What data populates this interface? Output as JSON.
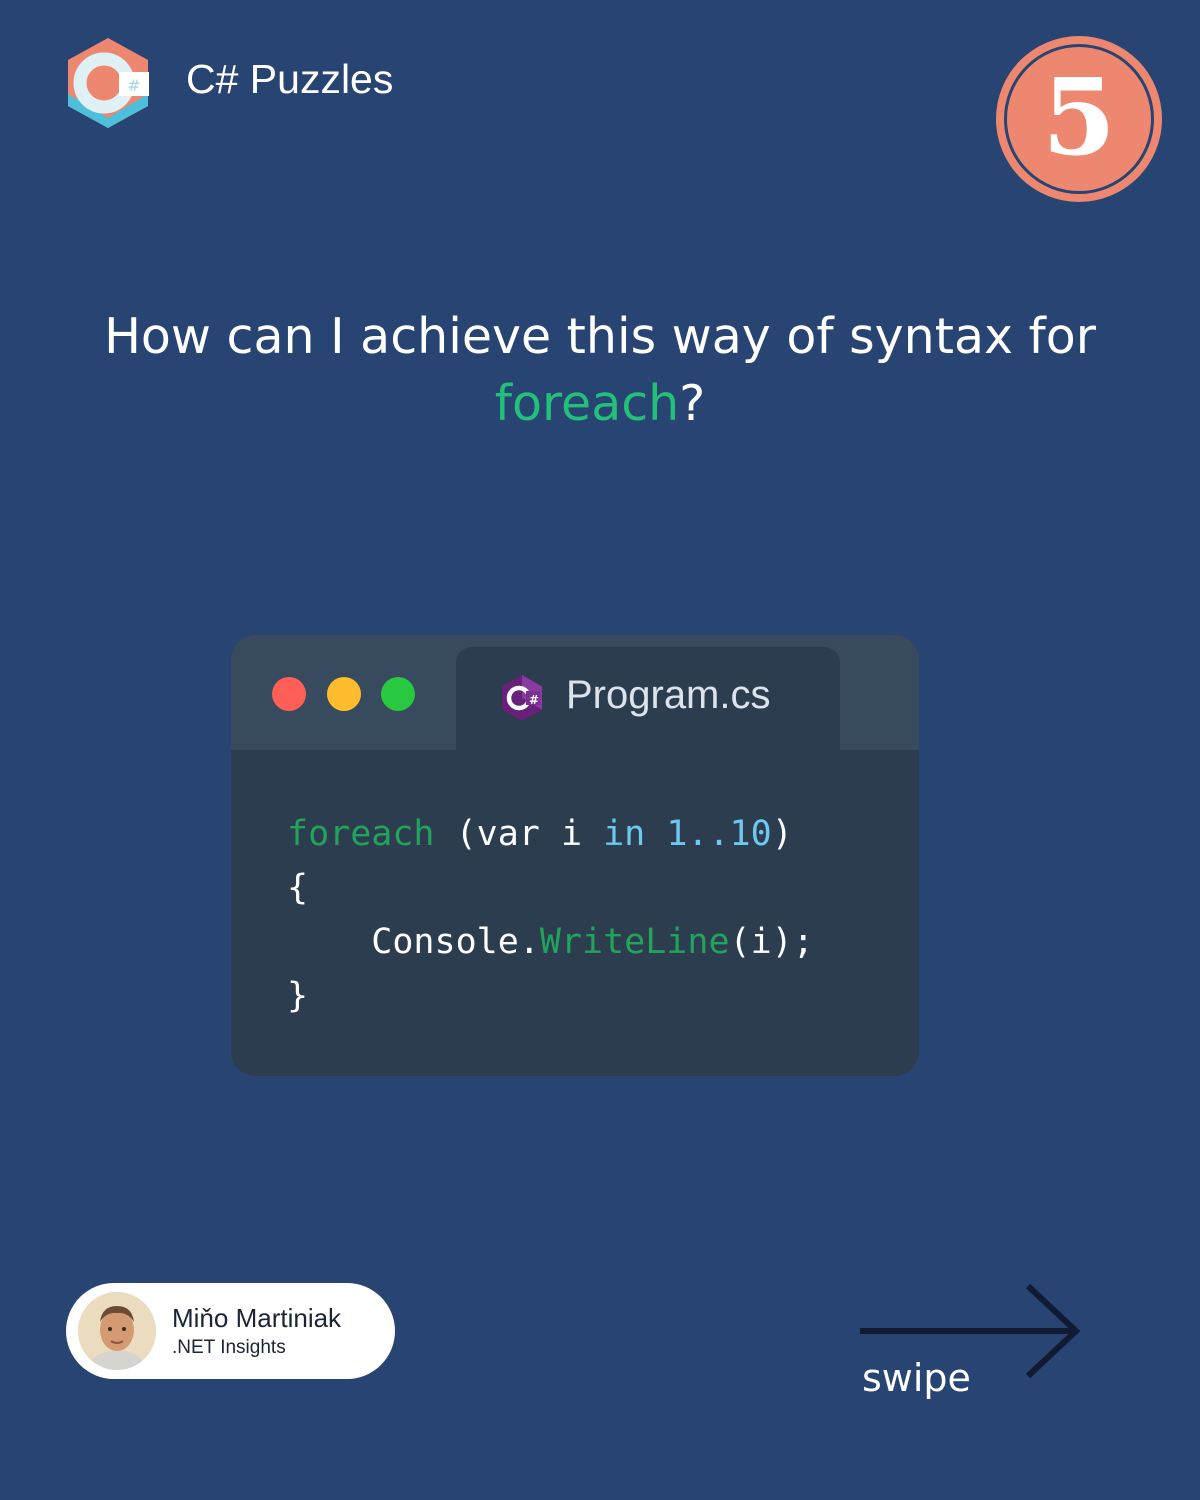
{
  "brand": {
    "title": "C# Puzzles",
    "logo_icon": "csharp-hexagon-logo-icon",
    "logo_colors": [
      "#ee8770",
      "#4cc0da",
      "#ffffff"
    ]
  },
  "badge": {
    "number": "5",
    "color": "#ee8770"
  },
  "question": {
    "text_before": "How can I achieve this way of syntax for ",
    "accent_word": "foreach",
    "text_after": "?",
    "accent_color": "#22c079"
  },
  "code_window": {
    "dots": [
      "#ff5f56",
      "#ffbd2e",
      "#28c840"
    ],
    "tab_icon": "csharp-file-icon",
    "tab_label": "Program.cs",
    "code": {
      "kw_foreach": "foreach",
      "t1": " (var i ",
      "kw_in": "in",
      "range": " 1..10",
      "t2": ")",
      "open_brace": "{",
      "indent_console": "    Console.",
      "method": "WriteLine",
      "call_args": "(i);",
      "close_brace": "}"
    }
  },
  "author": {
    "name": "Miňo Martiniak",
    "subtitle": ".NET Insights",
    "avatar_icon": "author-photo"
  },
  "navigation": {
    "swipe_label": "swipe",
    "arrow_icon": "arrow-right-icon"
  },
  "colors": {
    "background": "#284472",
    "window_body": "#2c3d50",
    "window_titlebar": "#384a5d"
  }
}
